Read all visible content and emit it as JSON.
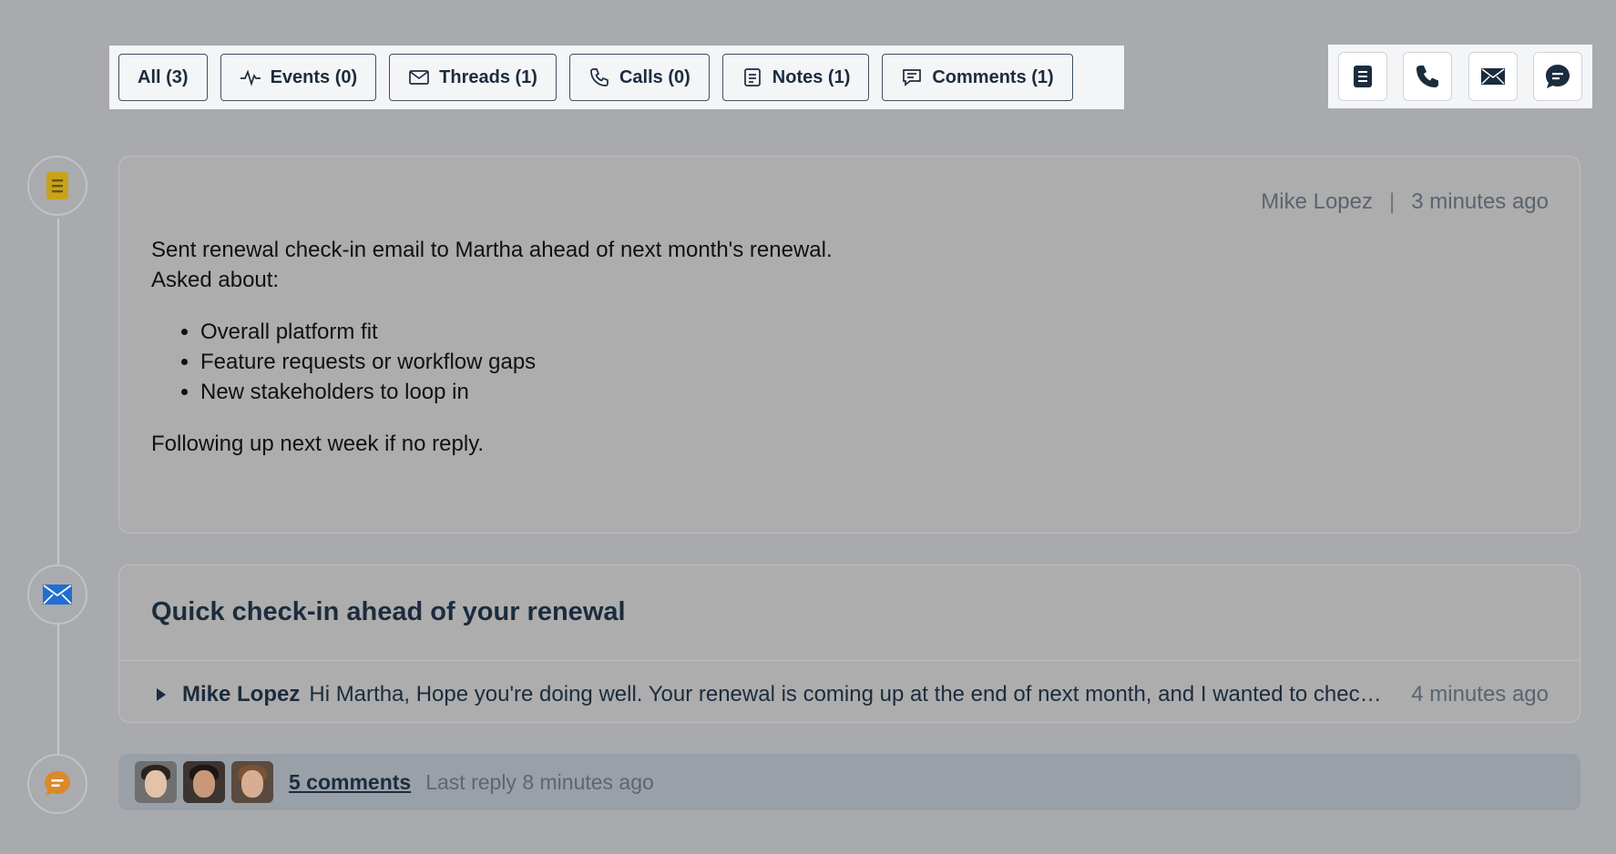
{
  "filters": [
    {
      "label": "All (3)",
      "icon": "none"
    },
    {
      "label": "Events (0)",
      "icon": "activity-icon"
    },
    {
      "label": "Threads (1)",
      "icon": "envelope-icon"
    },
    {
      "label": "Calls (0)",
      "icon": "phone-icon"
    },
    {
      "label": "Notes (1)",
      "icon": "note-icon"
    },
    {
      "label": "Comments (1)",
      "icon": "comment-icon"
    }
  ],
  "actions": [
    "add-note-icon",
    "phone-icon",
    "email-icon",
    "comment-icon"
  ],
  "note": {
    "author": "Mike Lopez",
    "separator": "|",
    "time": "3 minutes ago",
    "line1": "Sent renewal check-in email to Martha ahead of next month's renewal.",
    "line2": "Asked about:",
    "bullets": [
      "Overall platform fit",
      "Feature requests or workflow gaps",
      "New stakeholders to loop in"
    ],
    "footer": "Following up next week if no reply."
  },
  "thread": {
    "subject": "Quick check-in ahead of your renewal",
    "author": "Mike Lopez",
    "snippet": "Hi Martha, Hope you're doing well. Your renewal is coming up at the end of next month, and I wanted to check in to see how things are going and whether there's anything we can help with.",
    "time": "4 minutes ago"
  },
  "comments": {
    "count_label": "5 comments",
    "last_reply": "Last reply 8 minutes ago"
  },
  "colors": {
    "note_icon": "#c9a21a",
    "email_icon": "#1f6fd1",
    "comment_icon": "#d98a2b",
    "navy": "#1b2c3e"
  }
}
